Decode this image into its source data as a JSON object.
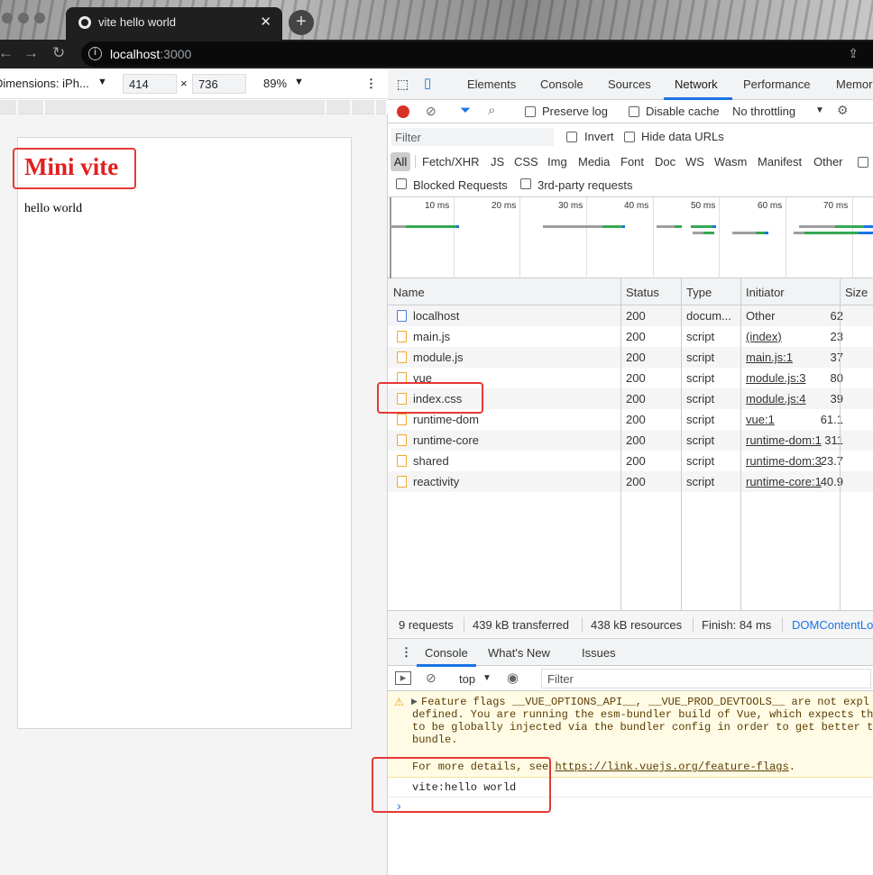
{
  "tab": {
    "title": "vite hello world",
    "close": "✕",
    "new": "+"
  },
  "address": {
    "host": "localhost",
    "port": ":3000"
  },
  "device": {
    "label": "Dimensions: iPh...",
    "width": "414",
    "times": "×",
    "height": "736",
    "zoom": "89%"
  },
  "page": {
    "heading": "Mini vite",
    "text": "hello world"
  },
  "devtools": {
    "tabs": [
      "Elements",
      "Console",
      "Sources",
      "Network",
      "Performance",
      "Memor"
    ],
    "toolbar": {
      "preserve_log": "Preserve log",
      "disable_cache": "Disable cache",
      "throttling": "No throttling"
    },
    "filter": {
      "placeholder": "Filter",
      "invert": "Invert",
      "hide_data": "Hide data URLs"
    },
    "types": [
      "All",
      "Fetch/XHR",
      "JS",
      "CSS",
      "Img",
      "Media",
      "Font",
      "Doc",
      "WS",
      "Wasm",
      "Manifest",
      "Other"
    ],
    "blocked": "Blocked Requests",
    "third_party": "3rd-party requests",
    "timeline_ticks": [
      "10 ms",
      "20 ms",
      "30 ms",
      "40 ms",
      "50 ms",
      "60 ms",
      "70 ms"
    ],
    "columns": [
      "Name",
      "Status",
      "Type",
      "Initiator",
      "Size"
    ],
    "rows": [
      {
        "name": "localhost",
        "status": "200",
        "type": "docum...",
        "initiator": "Other",
        "size": "62",
        "doc": true
      },
      {
        "name": "main.js",
        "status": "200",
        "type": "script",
        "initiator": "(index)",
        "size": "23"
      },
      {
        "name": "module.js",
        "status": "200",
        "type": "script",
        "initiator": "main.js:1",
        "size": "37"
      },
      {
        "name": "vue",
        "status": "200",
        "type": "script",
        "initiator": "module.js:3",
        "size": "80"
      },
      {
        "name": "index.css",
        "status": "200",
        "type": "script",
        "initiator": "module.js:4",
        "size": "39"
      },
      {
        "name": "runtime-dom",
        "status": "200",
        "type": "script",
        "initiator": "vue:1",
        "size": "61.1"
      },
      {
        "name": "runtime-core",
        "status": "200",
        "type": "script",
        "initiator": "runtime-dom:1",
        "size": "311"
      },
      {
        "name": "shared",
        "status": "200",
        "type": "script",
        "initiator": "runtime-dom:3",
        "size": "23.7"
      },
      {
        "name": "reactivity",
        "status": "200",
        "type": "script",
        "initiator": "runtime-core:1",
        "size": "40.9"
      }
    ],
    "summary": {
      "requests": "9 requests",
      "transferred": "439 kB transferred",
      "resources": "438 kB resources",
      "finish": "Finish: 84 ms",
      "dcl": "DOMContentLo"
    },
    "drawer_tabs": [
      "Console",
      "What's New",
      "Issues"
    ],
    "console": {
      "context": "top",
      "filter_placeholder": "Filter",
      "warning_lines": [
        "Feature flags __VUE_OPTIONS_API__, __VUE_PROD_DEVTOOLS__ are not expl",
        "defined. You are running the esm-bundler build of Vue, which expects th",
        "to be globally injected via the bundler config in order to get better t",
        "bundle."
      ],
      "more_prefix": "For more details, see ",
      "more_link": "https://link.vuejs.org/feature-flags",
      "more_suffix": ".",
      "log": "vite:hello world",
      "prompt": "›"
    }
  },
  "colors": {
    "accent": "#1a73e8",
    "highlight_red": "#e53935",
    "heading_red": "#e02020"
  }
}
